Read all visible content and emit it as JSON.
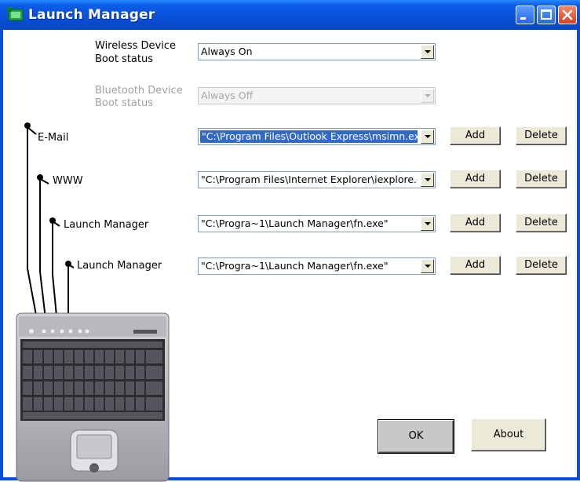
{
  "window": {
    "title": "Launch Manager"
  },
  "wireless": {
    "label_line1": "Wireless Device",
    "label_line2": "Boot status",
    "value": "Always On"
  },
  "bluetooth": {
    "label_line1": "Bluetooth Device",
    "label_line2": "Boot status",
    "value": "Always Off"
  },
  "keys": [
    {
      "label": "E-Mail",
      "path": "\"C:\\Program Files\\Outlook Express\\msimn.exe\""
    },
    {
      "label": "WWW",
      "path": "\"C:\\Program Files\\Internet Explorer\\iexplore.exe\""
    },
    {
      "label": "Launch Manager",
      "path": "\"C:\\Progra~1\\Launch Manager\\fn.exe\""
    },
    {
      "label": "Launch Manager",
      "path": "\"C:\\Progra~1\\Launch Manager\\fn.exe\""
    }
  ],
  "buttons": {
    "add": "Add",
    "delete": "Delete",
    "ok": "OK",
    "about": "About"
  },
  "colors": {
    "titlebar": "#0a4fd6",
    "selection": "#316ac5",
    "button_face": "#ece9d8"
  },
  "icons": [
    "launch-manager-app-icon",
    "minimize-icon",
    "maximize-icon",
    "close-icon",
    "dropdown-arrow-icon",
    "laptop-keyboard-image"
  ]
}
